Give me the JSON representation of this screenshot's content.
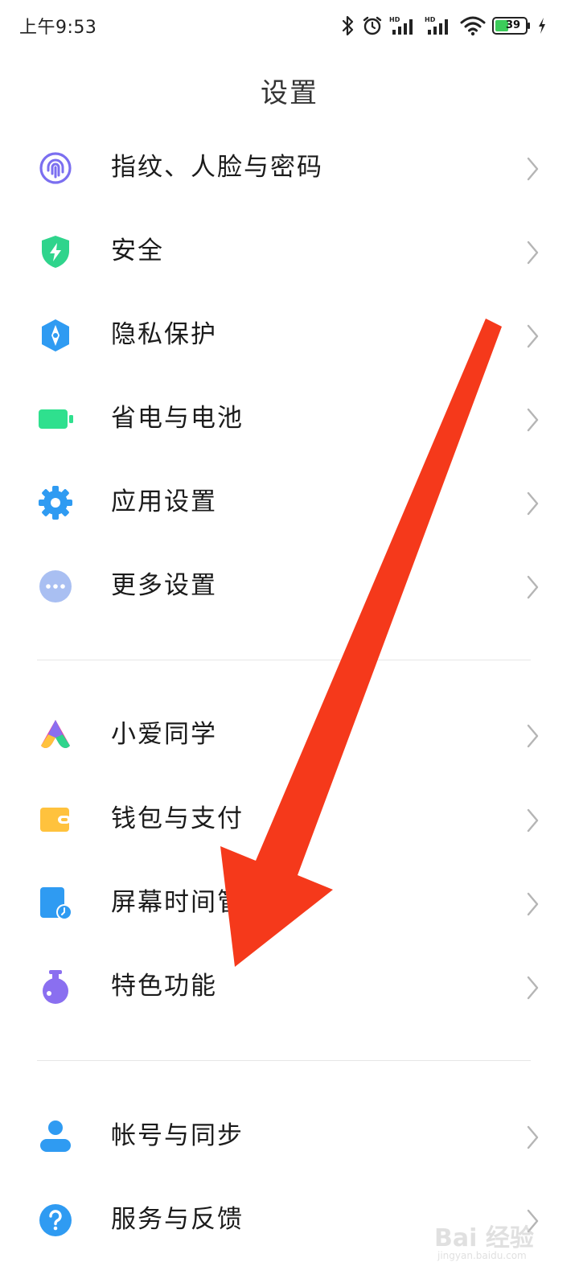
{
  "status_bar": {
    "time": "上午9:53",
    "battery": "39",
    "icons": [
      "bluetooth-icon",
      "alarm-icon",
      "signal-hd-1-icon",
      "signal-hd-2-icon",
      "wifi-icon",
      "battery-icon",
      "charging-icon"
    ]
  },
  "page": {
    "title": "设置"
  },
  "groups": [
    {
      "items": [
        {
          "label": "指纹、人脸与密码",
          "icon": "fingerprint-icon",
          "color": "#7b6ff0"
        },
        {
          "label": "安全",
          "icon": "security-shield-icon",
          "color": "#2fd48c"
        },
        {
          "label": "隐私保护",
          "icon": "privacy-icon",
          "color": "#2f9bf2"
        },
        {
          "label": "省电与电池",
          "icon": "battery-saver-icon",
          "color": "#2fe08e"
        },
        {
          "label": "应用设置",
          "icon": "app-settings-gear-icon",
          "color": "#2f9bf2"
        },
        {
          "label": "更多设置",
          "icon": "more-dots-icon",
          "color": "#a9bff2"
        }
      ]
    },
    {
      "items": [
        {
          "label": "小爱同学",
          "icon": "xiaoai-assistant-icon",
          "color": "#f2409b"
        },
        {
          "label": "钱包与支付",
          "icon": "wallet-icon",
          "color": "#ffc23d"
        },
        {
          "label": "屏幕时间管",
          "icon": "screen-time-icon",
          "color": "#2f9bf2"
        },
        {
          "label": "特色功能",
          "icon": "features-flask-icon",
          "color": "#8a6ff0"
        }
      ]
    },
    {
      "items": [
        {
          "label": "帐号与同步",
          "icon": "account-user-icon",
          "color": "#2f9bf2"
        },
        {
          "label": "服务与反馈",
          "icon": "help-question-icon",
          "color": "#2f9bf2"
        }
      ]
    }
  ],
  "annotation": {
    "arrow_color": "#f5391b"
  },
  "watermark": {
    "text": "Bai 经验",
    "sub": "jingyan.baidu.com"
  }
}
